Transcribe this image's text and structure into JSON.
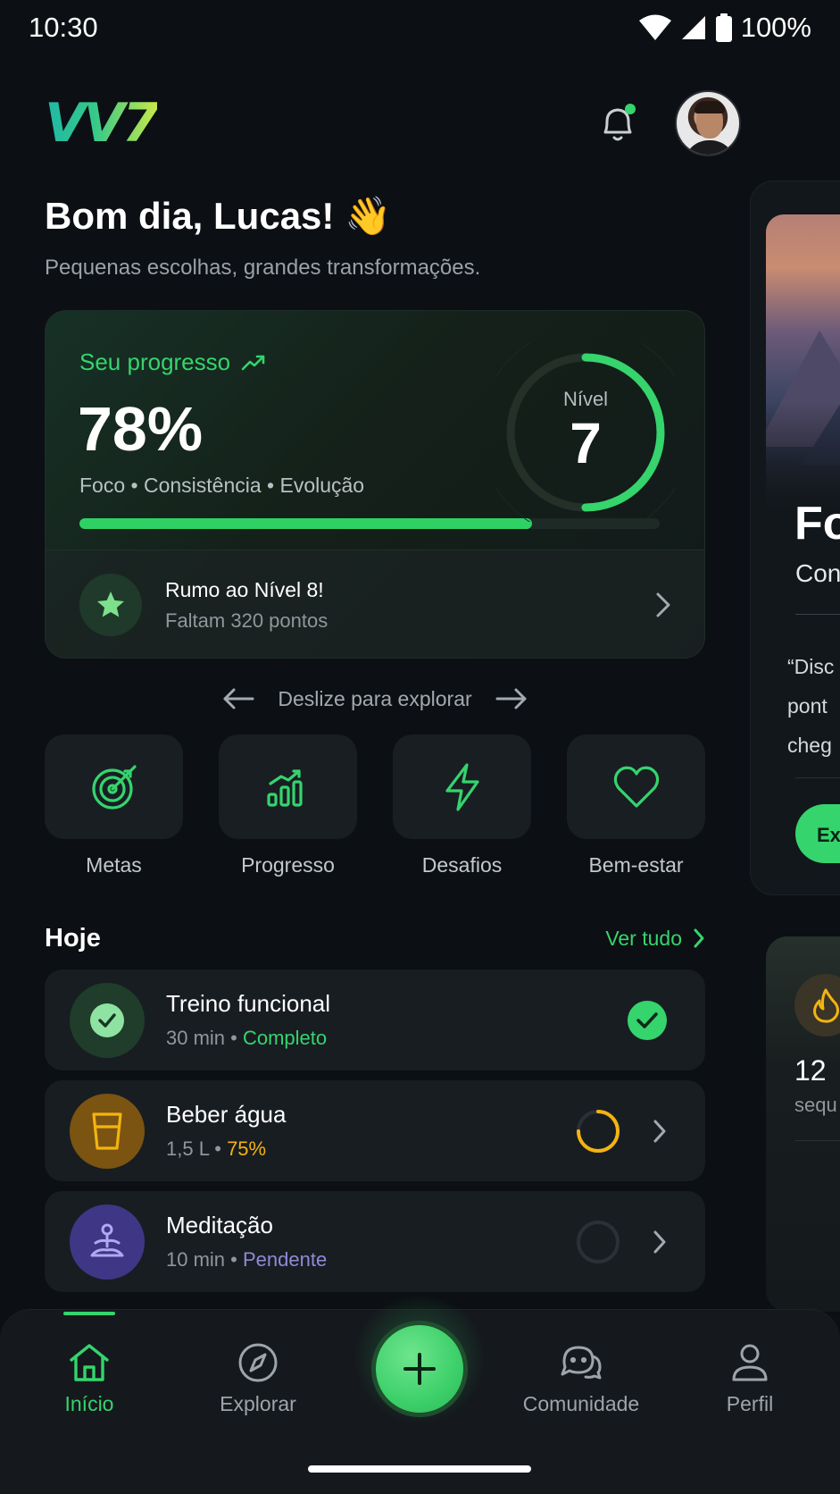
{
  "status_bar": {
    "time": "10:30",
    "battery": "100%"
  },
  "header": {
    "logo": "VV7",
    "icons": {
      "notifications": "bell-icon",
      "avatar": "user-avatar"
    }
  },
  "greeting": {
    "title": "Bom dia, Lucas! 👋",
    "subtitle": "Pequenas escolhas, grandes transformações."
  },
  "progress_card": {
    "label": "Seu progresso",
    "percent": "78%",
    "progress_value": 0.78,
    "tags": "Foco • Consistência • Evolução",
    "level_label": "Nível",
    "level_value": "7",
    "next_title": "Rumo ao Nível 8!",
    "next_subtitle": "Faltam 320 pontos"
  },
  "swipe_hint": "Deslize para explorar",
  "quick_actions": [
    {
      "label": "Metas",
      "icon": "target-icon"
    },
    {
      "label": "Progresso",
      "icon": "chart-icon"
    },
    {
      "label": "Desafios",
      "icon": "lightning-icon"
    },
    {
      "label": "Bem-estar",
      "icon": "heart-icon"
    }
  ],
  "today": {
    "title": "Hoje",
    "see_all": "Ver tudo",
    "tasks": [
      {
        "title": "Treino funcional",
        "amount": "30 min",
        "separator": " • ",
        "status": "Completo",
        "status_color": "#35d46d"
      },
      {
        "title": "Beber água",
        "amount": "1,5 L",
        "separator": " • ",
        "status": "75%",
        "status_color": "#f5b311",
        "progress_value": 0.75
      },
      {
        "title": "Meditação",
        "amount": "10 min",
        "separator": " • ",
        "status": "Pendente",
        "status_color": "#8f8ad6"
      }
    ]
  },
  "side_card": {
    "heading": "Fo",
    "subheading": "Con",
    "quote": "“Disc\npont\ncheg",
    "button": "Ex",
    "streak_value": "12",
    "streak_label": "sequ"
  },
  "bottom_nav": {
    "items": [
      {
        "label": "Início",
        "icon": "home-icon",
        "active": true
      },
      {
        "label": "Explorar",
        "icon": "compass-icon",
        "active": false
      },
      {
        "label": "Comunidade",
        "icon": "chat-icon",
        "active": false
      },
      {
        "label": "Perfil",
        "icon": "user-icon",
        "active": false
      }
    ],
    "fab_icon": "plus-icon"
  },
  "colors": {
    "background": "#0c0f13",
    "accent": "#35d46d",
    "water": "#f5b311",
    "meditation": "#8f8ad6"
  }
}
